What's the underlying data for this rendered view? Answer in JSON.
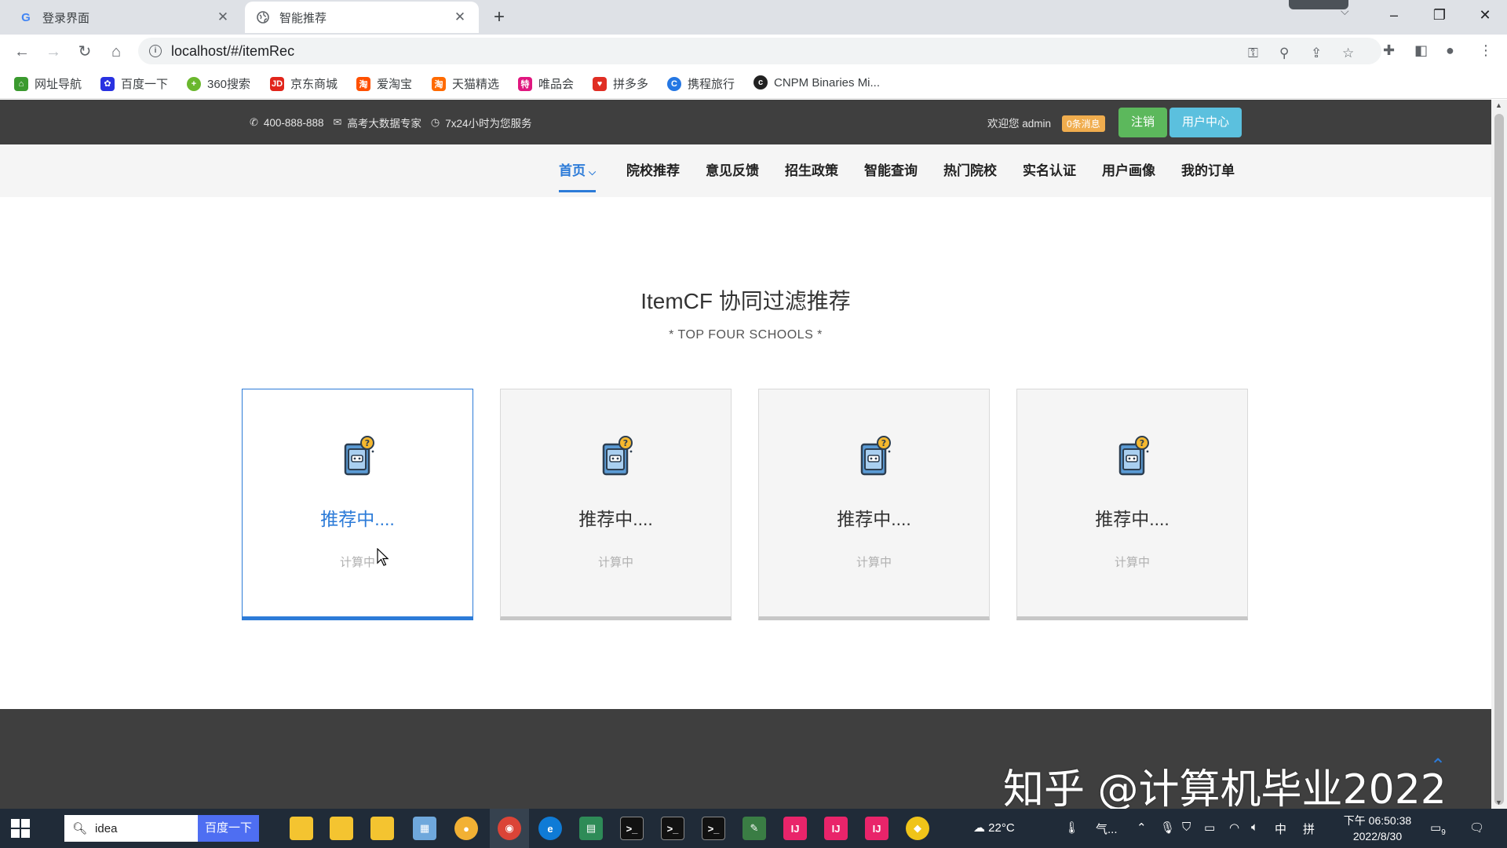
{
  "browser": {
    "tabs": [
      {
        "title": "登录界面",
        "active": false
      },
      {
        "title": "智能推荐",
        "active": true
      }
    ],
    "url": "localhost/#/itemRec",
    "bookmarks": [
      {
        "label": "网址导航",
        "icon": "globe-nav-icon",
        "color": "#3b9a2f"
      },
      {
        "label": "百度一下",
        "icon": "baidu-paw-icon",
        "color": "#2932e1"
      },
      {
        "label": "360搜索",
        "icon": "360-icon",
        "color": "#6ab72d"
      },
      {
        "label": "京东商城",
        "icon": "jd-icon",
        "color": "#e1251b"
      },
      {
        "label": "爱淘宝",
        "icon": "taobao-icon",
        "color": "#ff5000"
      },
      {
        "label": "天猫精选",
        "icon": "tmall-icon",
        "color": "#ff6a00"
      },
      {
        "label": "唯品会",
        "icon": "vip-icon",
        "color": "#e0177f"
      },
      {
        "label": "拼多多",
        "icon": "pdd-icon",
        "color": "#e02e24"
      },
      {
        "label": "携程旅行",
        "icon": "ctrip-icon",
        "color": "#2577e3"
      },
      {
        "label": "CNPM Binaries Mi...",
        "icon": "cnpm-icon",
        "color": "#222222"
      }
    ]
  },
  "topbar": {
    "phone": "400-888-888",
    "expert": "高考大数据专家",
    "service": "7x24小时为您服务",
    "welcome": "欢迎您 admin",
    "messages": "0条消息",
    "logout": "注销",
    "user_center": "用户中心"
  },
  "nav": {
    "items": [
      "首页",
      "院校推荐",
      "意见反馈",
      "招生政策",
      "智能查询",
      "热门院校",
      "实名认证",
      "用户画像",
      "我的订单"
    ],
    "active_index": 0
  },
  "section": {
    "title": "ItemCF 协同过滤推荐",
    "subtitle": "* TOP FOUR SCHOOLS *"
  },
  "cards": [
    {
      "title": "推荐中....",
      "status": "计算中",
      "active": true
    },
    {
      "title": "推荐中....",
      "status": "计算中",
      "active": false
    },
    {
      "title": "推荐中....",
      "status": "计算中",
      "active": false
    },
    {
      "title": "推荐中....",
      "status": "计算中",
      "active": false
    }
  ],
  "watermark": "知乎 @计算机毕业2022",
  "taskbar": {
    "search_text": "idea",
    "search_button": "百度一下",
    "weather": "22°C",
    "weather_label": "气...",
    "ime": "中",
    "ime2": "拼",
    "time": "下午 06:50:38",
    "date": "2022/8/30",
    "notifications": "9"
  },
  "colors": {
    "accent": "#2c7bd8",
    "topbar_bg": "#3f3f3f",
    "logout_btn": "#5cb85c",
    "user_btn": "#5bc0de",
    "badge": "#f0ad4e"
  }
}
